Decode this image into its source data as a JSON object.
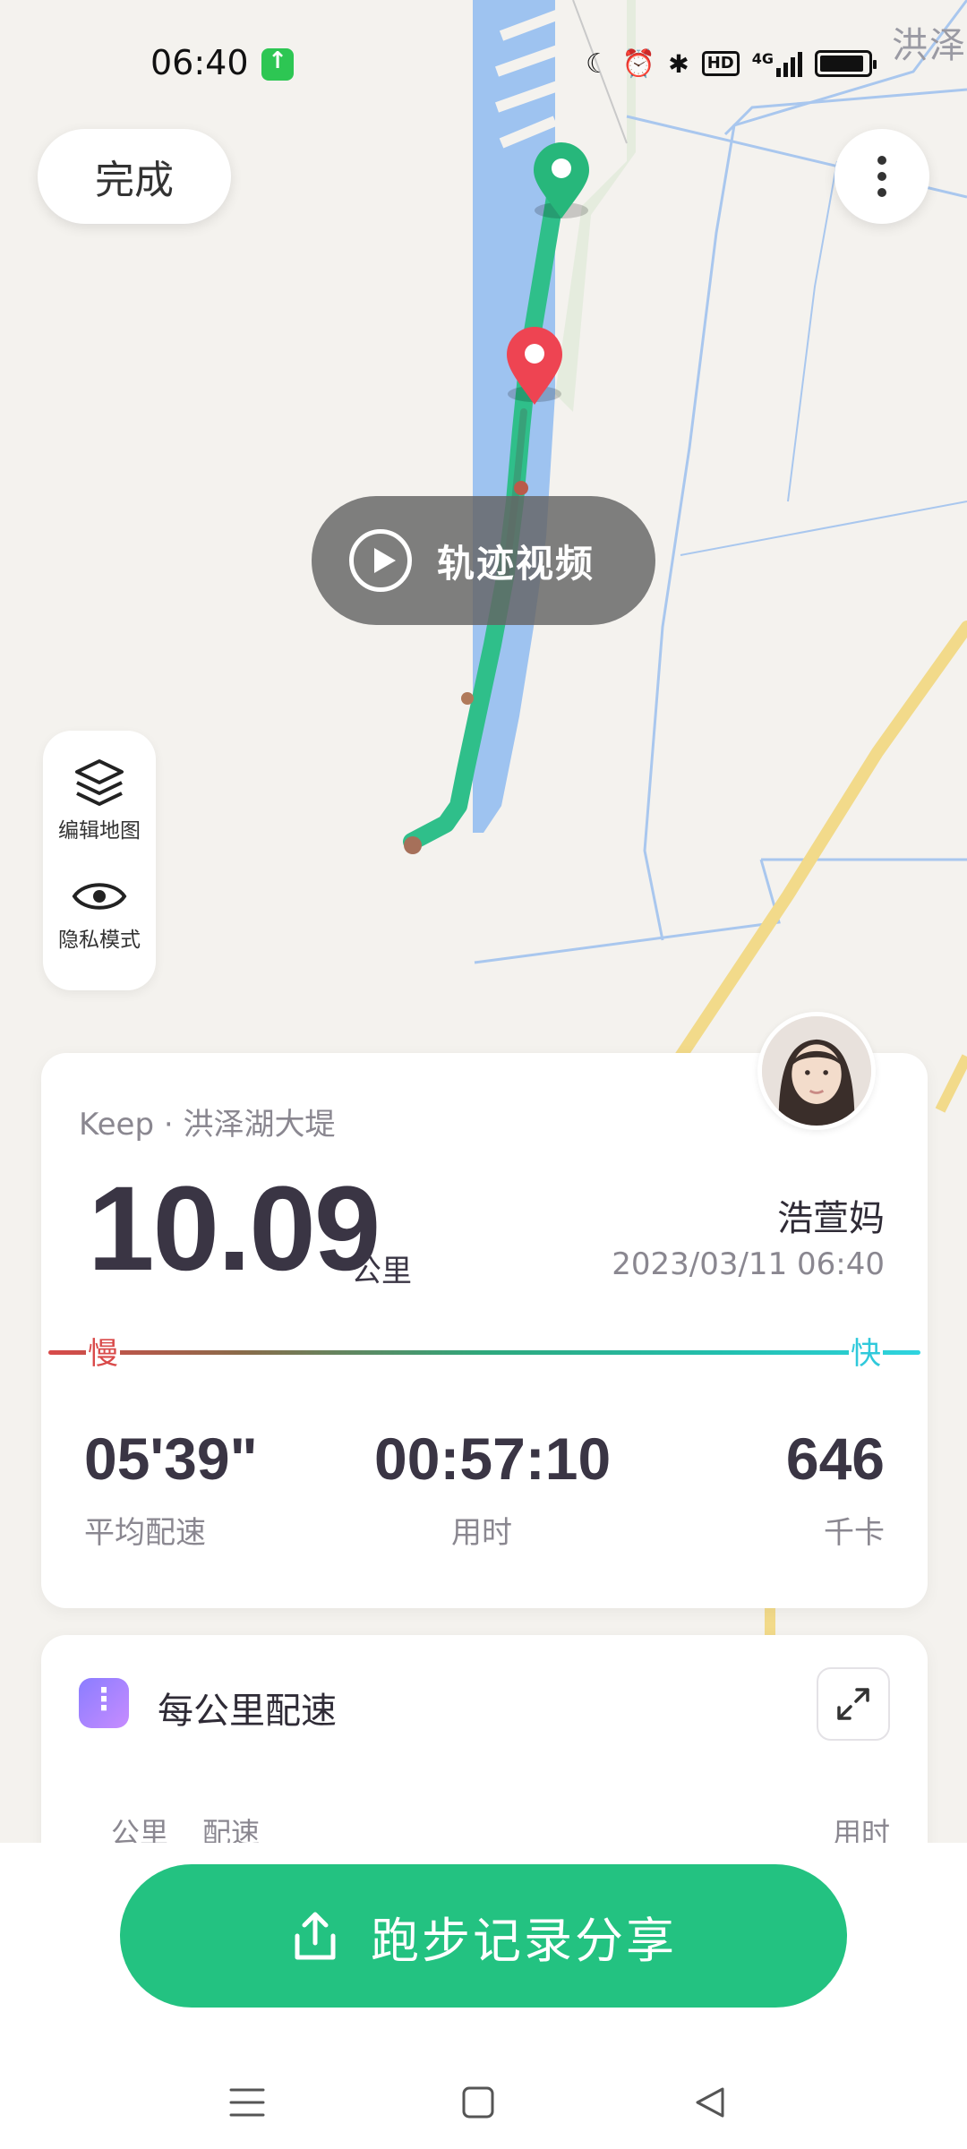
{
  "status_bar": {
    "time": "06:40",
    "icons": [
      "moon-icon",
      "alarm-icon",
      "bluetooth-icon",
      "hd-icon",
      "signal-4g-icon",
      "battery-icon"
    ],
    "hd_label": "HD",
    "network_label": "4G"
  },
  "map": {
    "place_label": "洪泽",
    "water_color": "#9ec3f0",
    "route_color": "#2fbf8a"
  },
  "top": {
    "done_label": "完成",
    "more_icon": "more-vertical-icon"
  },
  "video": {
    "label": "轨迹视频",
    "icon": "play-circle-icon"
  },
  "side_panel": {
    "items": [
      {
        "label": "编辑地图",
        "icon": "layers-icon"
      },
      {
        "label": "隐私模式",
        "icon": "eye-icon"
      }
    ]
  },
  "summary": {
    "source": "Keep · 洪泽湖大堤",
    "distance": "10.09",
    "distance_unit": "公里",
    "user": "浩萱妈",
    "datetime": "2023/03/11 06:40",
    "pace_slow": "慢",
    "pace_fast": "快",
    "stats": [
      {
        "value": "05'39\"",
        "label": "平均配速"
      },
      {
        "value": "00:57:10",
        "label": "用时"
      },
      {
        "value": "646",
        "label": "千卡"
      }
    ]
  },
  "per_km": {
    "title": "每公里配速",
    "columns": [
      "公里",
      "配速",
      "用时"
    ]
  },
  "share": {
    "label": "跑步记录分享",
    "color": "#23c281"
  },
  "nav": {
    "items": [
      "menu-icon",
      "home-square-icon",
      "back-triangle-icon"
    ]
  }
}
